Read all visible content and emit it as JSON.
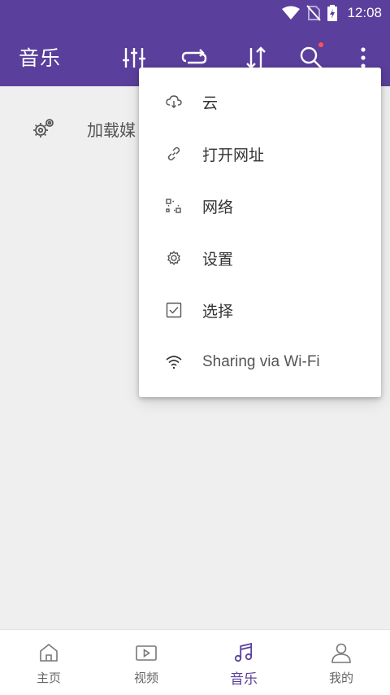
{
  "status_bar": {
    "time": "12:08"
  },
  "app_bar": {
    "title": "音乐"
  },
  "content": {
    "load_media_label": "加载媒"
  },
  "overflow_menu": {
    "items": [
      {
        "label": "云",
        "icon": "cloud-download-icon"
      },
      {
        "label": "打开网址",
        "icon": "link-icon"
      },
      {
        "label": "网络",
        "icon": "network-icon"
      },
      {
        "label": "设置",
        "icon": "gear-icon"
      },
      {
        "label": "选择",
        "icon": "checkbox-icon"
      },
      {
        "label": "Sharing via Wi-Fi",
        "icon": "wifi-icon"
      }
    ]
  },
  "bottom_nav": {
    "items": [
      {
        "label": "主页",
        "icon": "home-icon"
      },
      {
        "label": "视频",
        "icon": "video-icon"
      },
      {
        "label": "音乐",
        "icon": "music-icon",
        "active": true
      },
      {
        "label": "我的",
        "icon": "person-icon"
      }
    ]
  },
  "colors": {
    "primary": "#5a3f9c",
    "badge": "#ff5252",
    "background": "#efefef"
  }
}
